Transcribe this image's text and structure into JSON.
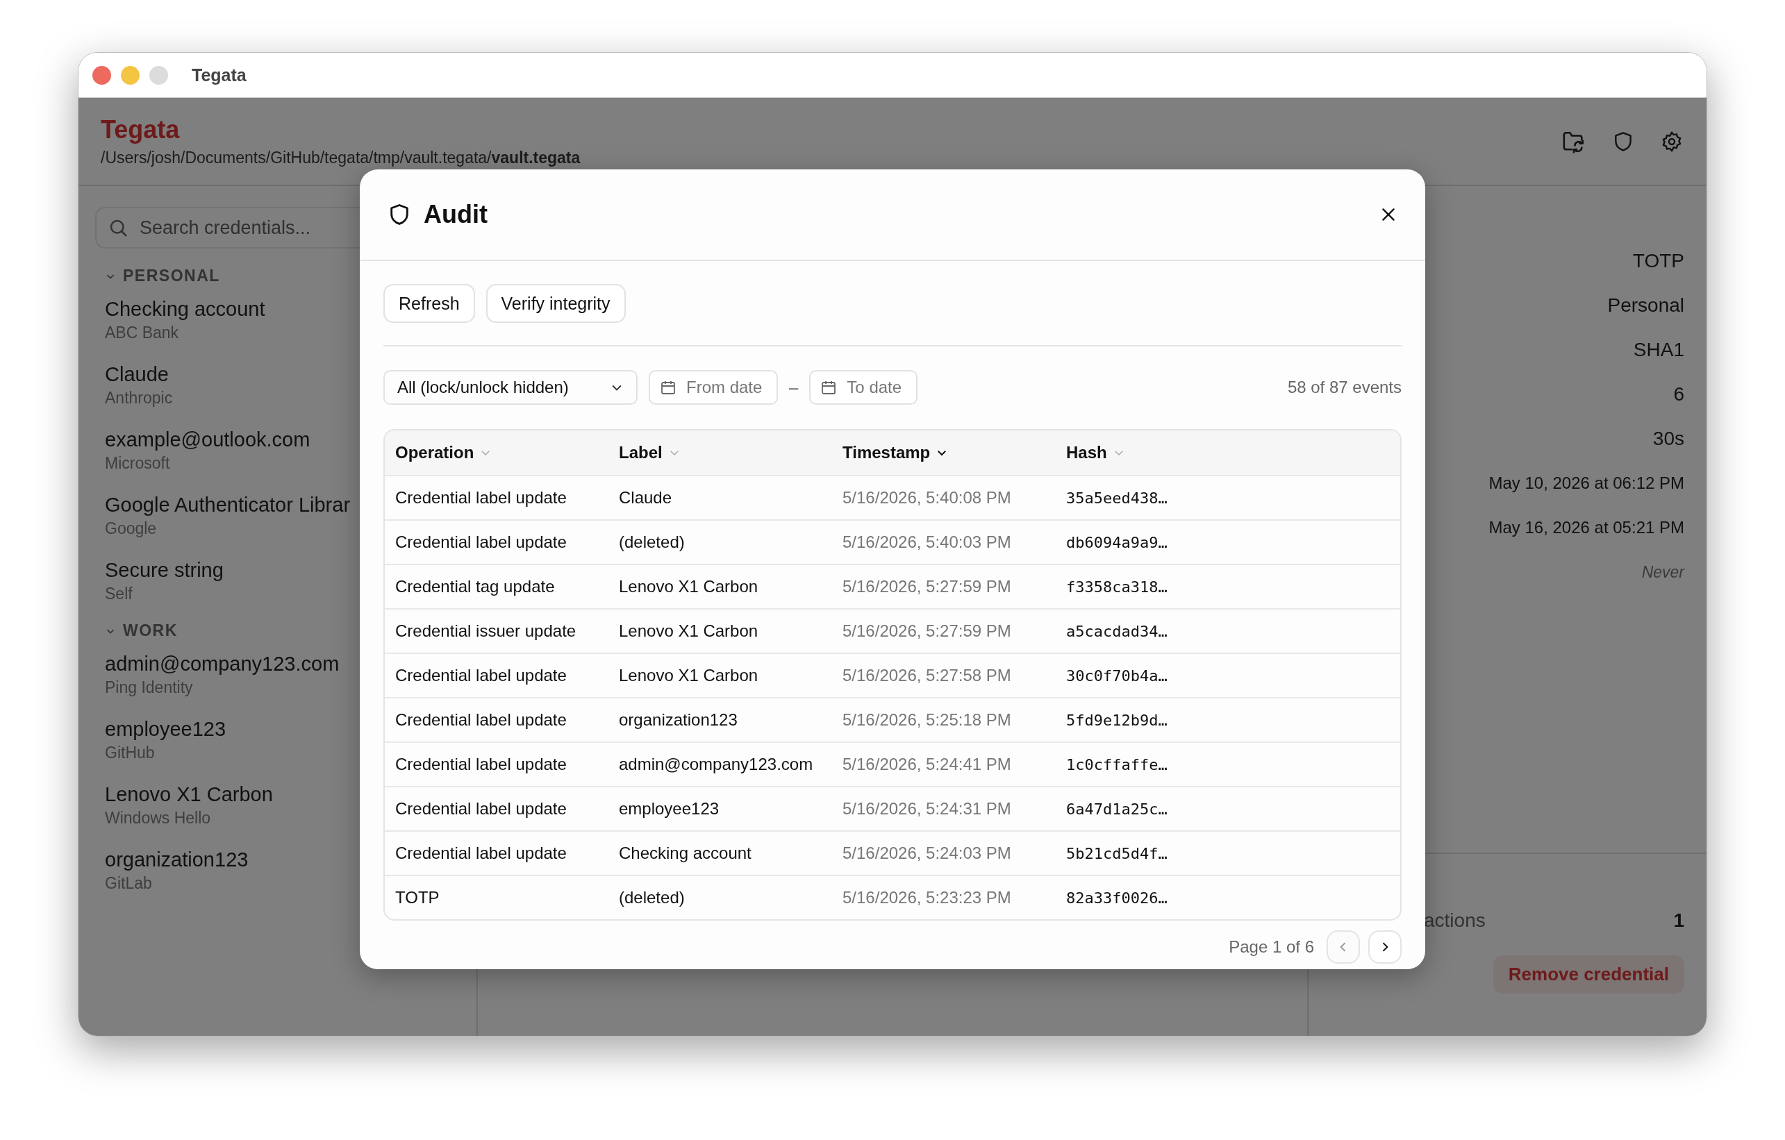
{
  "window": {
    "title": "Tegata"
  },
  "app_header": {
    "title": "Tegata",
    "path": "/Users/josh/Documents/GitHub/tegata/tmp/vault.tegata/**vault.tegata**"
  },
  "sidebar": {
    "search": {
      "placeholder": "Search credentials..."
    },
    "groups": [
      {
        "name": "PERSONAL",
        "expanded": true,
        "items": [
          {
            "name": "Checking account",
            "issuer": "ABC Bank"
          },
          {
            "name": "Claude",
            "issuer": "Anthropic"
          },
          {
            "name": "example@outlook.com",
            "issuer": "Microsoft"
          },
          {
            "name": "Google Authenticator Librar",
            "issuer": "Google"
          },
          {
            "name": "Secure string",
            "issuer": "Self"
          }
        ]
      },
      {
        "name": "WORK",
        "expanded": true,
        "items": [
          {
            "name": "admin@company123.com",
            "issuer": "Ping Identity"
          },
          {
            "name": "employee123",
            "issuer": "GitHub"
          },
          {
            "name": "Lenovo X1 Carbon",
            "issuer": "Windows Hello"
          },
          {
            "name": "organization123",
            "issuer": "GitLab"
          }
        ]
      }
    ]
  },
  "details": {
    "values": [
      {
        "kind": "large",
        "text": "TOTP"
      },
      {
        "kind": "large",
        "text": "Personal"
      },
      {
        "kind": "large",
        "text": "SHA1"
      },
      {
        "kind": "large",
        "text": "6"
      },
      {
        "kind": "large",
        "text": "30s"
      },
      {
        "kind": "date",
        "text": "May 10, 2026 at 06:12 PM"
      },
      {
        "kind": "date",
        "text": "May 16, 2026 at 05:21 PM"
      },
      {
        "kind": "empty",
        "text": "Never"
      }
    ],
    "actions_label": "actions",
    "actions_value": "1",
    "remove_button": "Remove credential"
  },
  "dialog": {
    "title": "Audit",
    "buttons": [
      "Refresh",
      "Verify integrity"
    ],
    "filter": {
      "value": "All (lock/unlock hidden)"
    },
    "from_date": {
      "placeholder": "From date"
    },
    "separator": "–",
    "to_date": {
      "placeholder": "To date"
    },
    "count": "58 of 87 events",
    "table": {
      "columns": [
        {
          "label": "Operation",
          "sorted": false
        },
        {
          "label": "Label",
          "sorted": false
        },
        {
          "label": "Timestamp",
          "sorted": true
        },
        {
          "label": "Hash",
          "sorted": false
        }
      ],
      "rows": [
        [
          "Credential label update",
          "Claude",
          "5/16/2026, 5:40:08 PM",
          "35a5eed438…"
        ],
        [
          "Credential label update",
          "(deleted)",
          "5/16/2026, 5:40:03 PM",
          "db6094a9a9…"
        ],
        [
          "Credential tag update",
          "Lenovo X1 Carbon",
          "5/16/2026, 5:27:59 PM",
          "f3358ca318…"
        ],
        [
          "Credential issuer update",
          "Lenovo X1 Carbon",
          "5/16/2026, 5:27:59 PM",
          "a5cacdad34…"
        ],
        [
          "Credential label update",
          "Lenovo X1 Carbon",
          "5/16/2026, 5:27:58 PM",
          "30c0f70b4a…"
        ],
        [
          "Credential label update",
          "organization123",
          "5/16/2026, 5:25:18 PM",
          "5fd9e12b9d…"
        ],
        [
          "Credential label update",
          "admin@company123.com",
          "5/16/2026, 5:24:41 PM",
          "1c0cffaffe…"
        ],
        [
          "Credential label update",
          "employee123",
          "5/16/2026, 5:24:31 PM",
          "6a47d1a25c…"
        ],
        [
          "Credential label update",
          "Checking account",
          "5/16/2026, 5:24:03 PM",
          "5b21cd5d4f…"
        ],
        [
          "TOTP",
          "(deleted)",
          "5/16/2026, 5:23:23 PM",
          "82a33f0026…"
        ]
      ]
    },
    "pagination": {
      "text": "Page 1 of 6",
      "prev_disabled": true,
      "next_disabled": false
    }
  }
}
